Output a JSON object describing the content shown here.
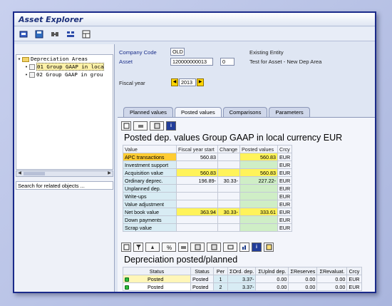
{
  "window": {
    "title": "Asset Explorer"
  },
  "toolbar": {
    "icons": [
      "open-icon",
      "save-icon",
      "find-icon",
      "group-icon",
      "layout-icon"
    ]
  },
  "tree": {
    "root_label": "Depreciation Areas",
    "items": [
      {
        "label": "01 Group GAAP in loca",
        "selected": true
      },
      {
        "label": "02 Group GAAP in grou",
        "selected": false
      }
    ]
  },
  "search_related": "Search for related objects ...",
  "header": {
    "company_code_label": "Company Code",
    "company_code_value": "OLD",
    "company_text": "Existing Entity",
    "asset_label": "Asset",
    "asset_value": "120000000013",
    "asset_sub_value": "0",
    "asset_text": "Test for Asset - New Dep Area",
    "fiscal_year_label": "Fiscal year",
    "fiscal_year_value": "2013"
  },
  "tabs": [
    {
      "label": "Planned values",
      "active": false
    },
    {
      "label": "Posted values",
      "active": true
    },
    {
      "label": "Comparisons",
      "active": false
    },
    {
      "label": "Parameters",
      "active": false
    }
  ],
  "posted_table": {
    "title": "Posted dep. values Group GAAP in local currency EUR",
    "headers": [
      "Value",
      "Fiscal year start",
      "Change",
      "Posted values",
      "Crcy"
    ],
    "rows": [
      {
        "value": "APC transactions",
        "fys": "560.83",
        "chg": "",
        "posted": "560.83",
        "crcy": "EUR",
        "hl_value": true
      },
      {
        "value": "Investment support",
        "fys": "",
        "chg": "",
        "posted": "",
        "crcy": "EUR"
      },
      {
        "value": "Acquisition value",
        "fys": "560.83",
        "chg": "",
        "posted": "560.83",
        "crcy": "EUR",
        "hl": true
      },
      {
        "value": "Ordinary deprec.",
        "fys": "196.89-",
        "chg": "30.33-",
        "posted": "227.22-",
        "crcy": "EUR"
      },
      {
        "value": "Unplanned dep.",
        "fys": "",
        "chg": "",
        "posted": "",
        "crcy": "EUR"
      },
      {
        "value": "Write-ups",
        "fys": "",
        "chg": "",
        "posted": "",
        "crcy": "EUR"
      },
      {
        "value": "Value adjustment",
        "fys": "",
        "chg": "",
        "posted": "",
        "crcy": "EUR"
      },
      {
        "value": "Net book value",
        "fys": "363.94",
        "chg": "30.33-",
        "posted": "333.61",
        "crcy": "EUR",
        "hl": true
      },
      {
        "value": "Down payments",
        "fys": "",
        "chg": "",
        "posted": "",
        "crcy": "EUR"
      },
      {
        "value": "Scrap value",
        "fys": "",
        "chg": "",
        "posted": "",
        "crcy": "EUR"
      }
    ]
  },
  "dep_table": {
    "title": "Depreciation posted/planned",
    "headers": [
      "Status",
      "Status",
      "Per",
      "ΣOrd. dep.",
      "ΣUplnd dep.",
      "ΣReserves",
      "ΣRevaluat.",
      "Crcy"
    ],
    "rows": [
      {
        "status_icon": "green-status-icon",
        "status": "Posted",
        "status2": "Posted",
        "per": "1",
        "ord": "3.37-",
        "uplnd": "0.00",
        "reserves": "0.00",
        "reval": "0.00",
        "crcy": "EUR"
      },
      {
        "status_icon": "green-status-icon",
        "status": "Posted",
        "status2": "Posted",
        "per": "2",
        "ord": "3.37-",
        "uplnd": "0.00",
        "reserves": "0.00",
        "reval": "0.00",
        "crcy": "EUR"
      }
    ]
  },
  "colors": {
    "highlight": "#fff35a",
    "value_highlight": "#ffcc33",
    "value_col": "#d8ecf4",
    "posted_col": "#cfeec6"
  }
}
